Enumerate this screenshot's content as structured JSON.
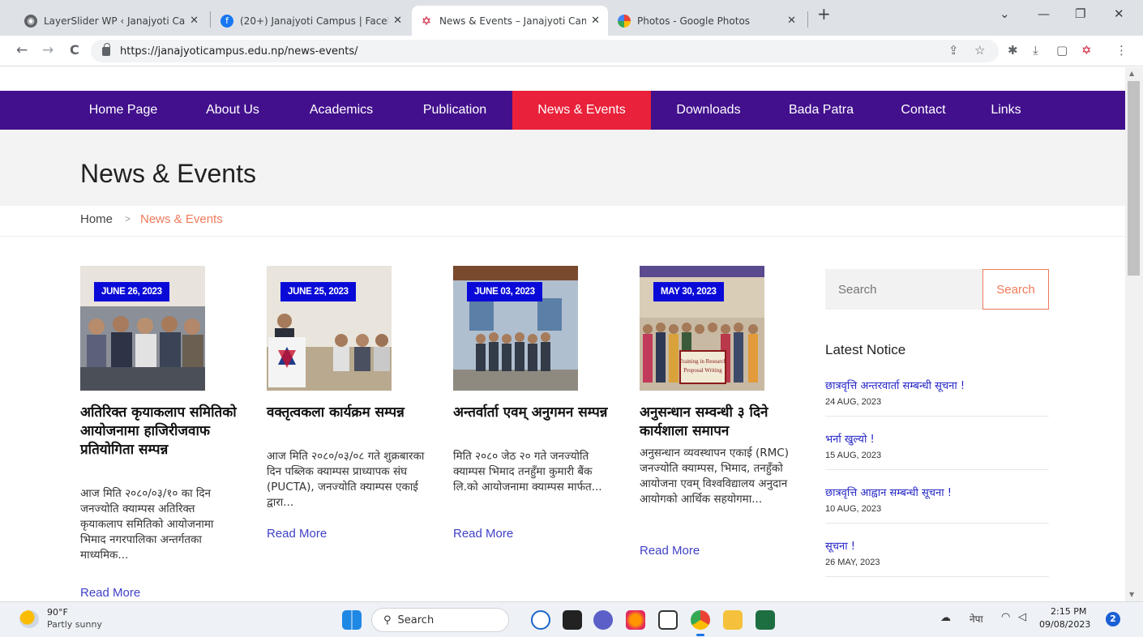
{
  "browser": {
    "tabs": [
      {
        "title": "LayerSlider WP ‹ Janajyoti Campus",
        "icon": "globe-icon",
        "active": false
      },
      {
        "title": "(20+) Janajyoti Campus | Facebook",
        "icon": "facebook-icon",
        "active": false
      },
      {
        "title": "News & Events – Janajyoti Campus",
        "icon": "nepal-emblem-icon",
        "active": true
      },
      {
        "title": "Photos - Google Photos",
        "icon": "google-photos-icon",
        "active": false
      }
    ],
    "new_tab": "+",
    "window": {
      "dropdown": "⌄",
      "minimize": "—",
      "restore": "❐",
      "close": "✕"
    },
    "url": "https://janajyoticampus.edu.np/news-events/",
    "nav_icons": {
      "back": "←",
      "forward": "→",
      "reload": "C"
    }
  },
  "nav": {
    "items": [
      {
        "label": "Home Page"
      },
      {
        "label": "About Us"
      },
      {
        "label": "Academics"
      },
      {
        "label": "Publication"
      },
      {
        "label": "News & Events",
        "active": true
      },
      {
        "label": "Downloads"
      },
      {
        "label": "Bada Patra"
      },
      {
        "label": "Contact"
      },
      {
        "label": "Links"
      }
    ],
    "bg_color": "#42108d",
    "active_color": "#e9213a"
  },
  "page": {
    "title": "News & Events",
    "breadcrumb": {
      "home": "Home",
      "sep": ">",
      "current": "News & Events"
    }
  },
  "posts": [
    {
      "date": "JUNE 26, 2023",
      "title": "अतिरिक्त कृयाकलाप समितिको आयोजनामा हाजिरीजवाफ प्रतियोगिता सम्पन्न",
      "excerpt": "आज मिति २०८०/०३/१० का दिन जनज्योति क्याम्पस अतिरिक्त कृयाकलाप समितिको आयोजनामा भिमाद नगरपालिका अन्तर्गतका माध्यमिक...",
      "read_more": "Read More"
    },
    {
      "date": "JUNE 25, 2023",
      "title": "वक्तृत्वकला कार्यक्रम सम्पन्न",
      "excerpt": "आज मिति २०८०/०३/०८ गते शुक्रबारका दिन पब्लिक क्याम्पस प्राध्यापक संघ (PUCTA), जनज्योति क्याम्पस एकाई द्वारा...",
      "read_more": "Read More"
    },
    {
      "date": "JUNE 03, 2023",
      "title": "अन्तर्वार्ता एवम् अनुगमन सम्पन्न",
      "excerpt": "मिति २०८० जेठ २० गते जनज्योति क्याम्पस भिमाद तनहुँमा कुमारी बैंक लि.को आयोजनामा क्याम्पस मार्फत...",
      "read_more": "Read More"
    },
    {
      "date": "MAY 30, 2023",
      "title": "अनुसन्धान सम्वन्धी ३ दिने कार्यशाला समापन",
      "excerpt": "अनुसन्धान व्यवस्थापन एकाई (RMC) जनज्योति क्याम्पस, भिमाद, तनहुँको आयोजना एवम् विश्वविद्यालय अनुदान आयोगको आर्थिक सहयोगमा...",
      "read_more": "Read More"
    }
  ],
  "sidebar": {
    "search_placeholder": "Search",
    "search_button": "Search",
    "latest_title": "Latest Notice",
    "notices": [
      {
        "title": "छात्रवृत्ति अन्तरवार्ता सम्बन्धी सूचना !",
        "date": "24 AUG, 2023"
      },
      {
        "title": "भर्ना खुल्यो !",
        "date": "15 AUG, 2023"
      },
      {
        "title": "छात्रवृत्ति आह्वान सम्बन्धी सूचना !",
        "date": "10 AUG, 2023"
      },
      {
        "title": "सूचना !",
        "date": "26 MAY, 2023"
      }
    ]
  },
  "taskbar": {
    "weather_temp": "90°F",
    "weather_desc": "Partly sunny",
    "search_label": "Search",
    "lang": "नेपा",
    "time": "2:15 PM",
    "date": "09/08/2023",
    "notif_count": "2"
  }
}
